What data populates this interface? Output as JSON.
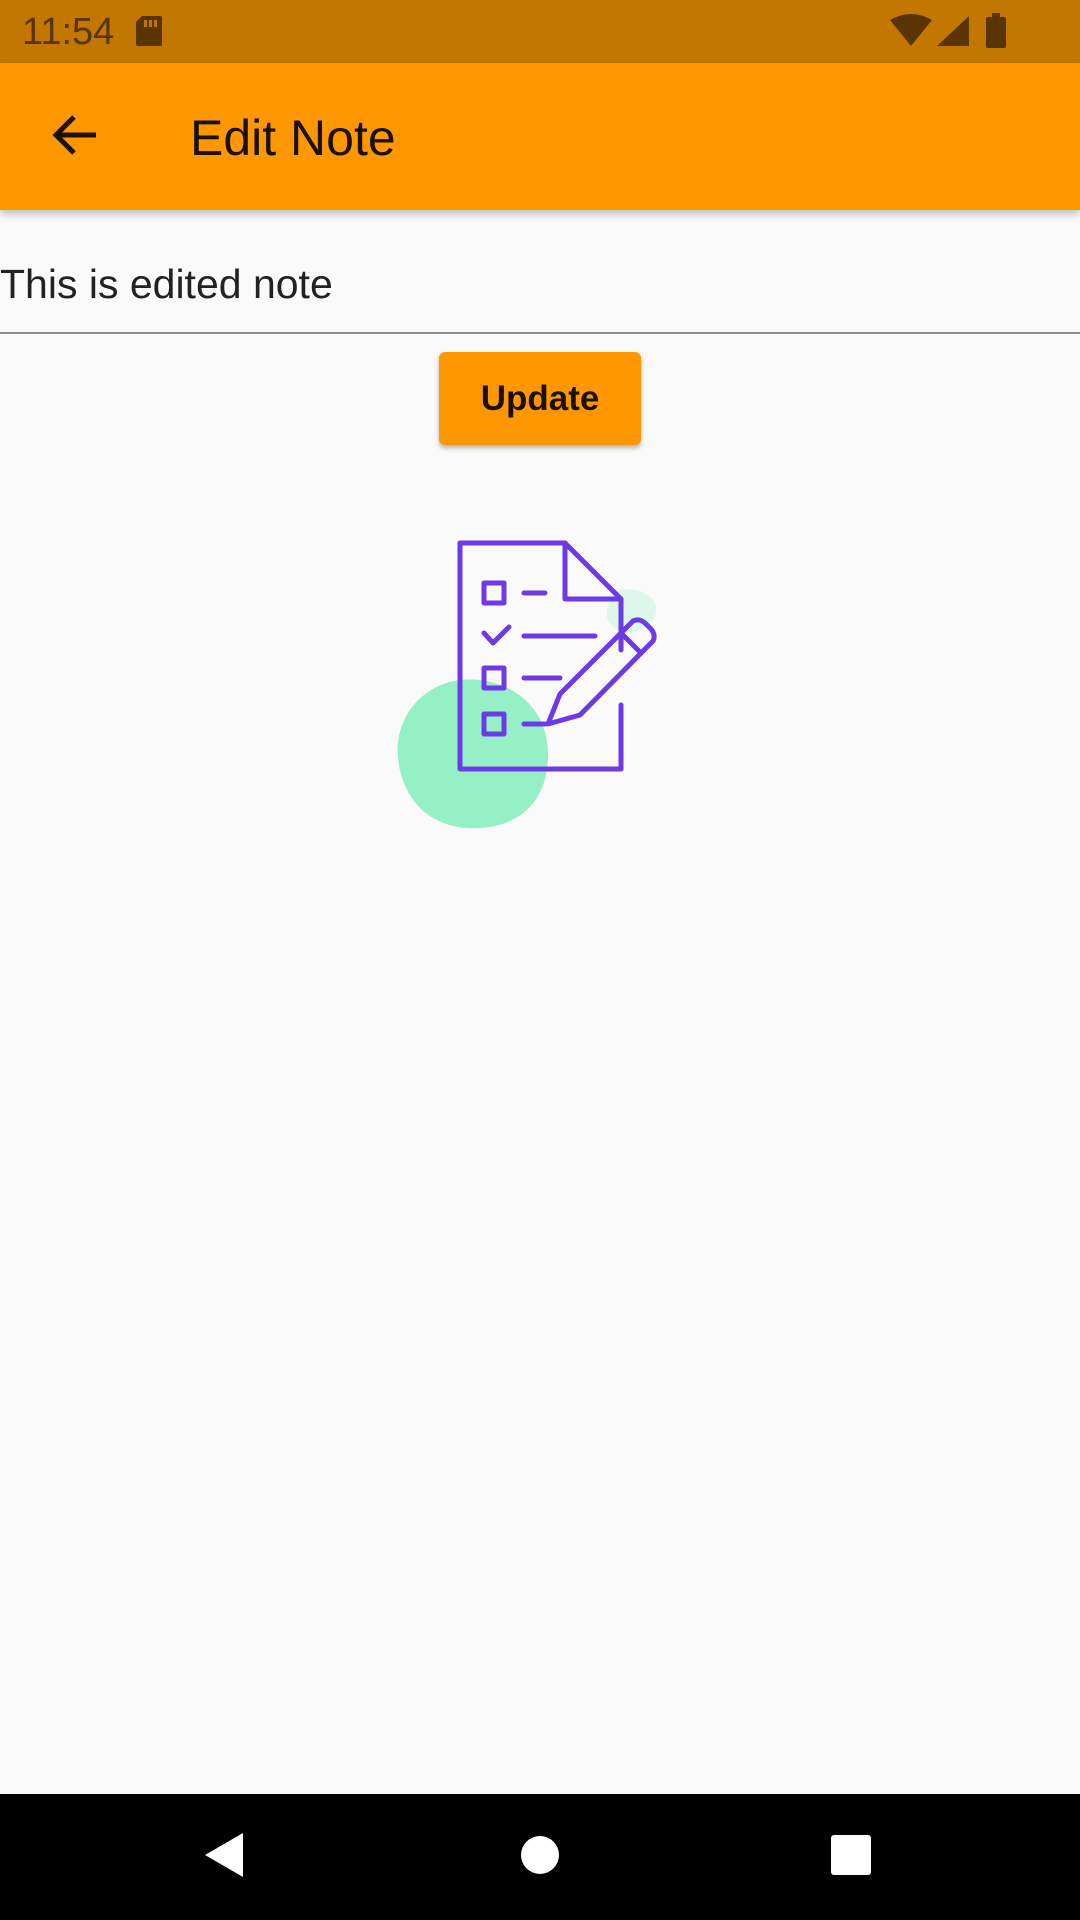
{
  "status_bar": {
    "time": "11:54",
    "icons": [
      "sd-card-icon",
      "wifi-icon",
      "cell-signal-icon",
      "battery-icon"
    ]
  },
  "app_bar": {
    "title": "Edit Note",
    "back_icon": "arrow-left-icon",
    "color": "#ff9800"
  },
  "note": {
    "value": "This is edited note"
  },
  "actions": {
    "update_label": "Update"
  },
  "illustration": {
    "name": "checklist-edit-illustration",
    "colors": {
      "stroke": "#6c3be6",
      "blob": "#95f0c5",
      "blob_light": "#ddf7ea"
    }
  },
  "nav_bar": {
    "icons": [
      "nav-back-icon",
      "nav-home-icon",
      "nav-recents-icon"
    ]
  },
  "colors": {
    "status_bar": "#c17700",
    "accent": "#ff9800",
    "background": "#fafafa"
  }
}
